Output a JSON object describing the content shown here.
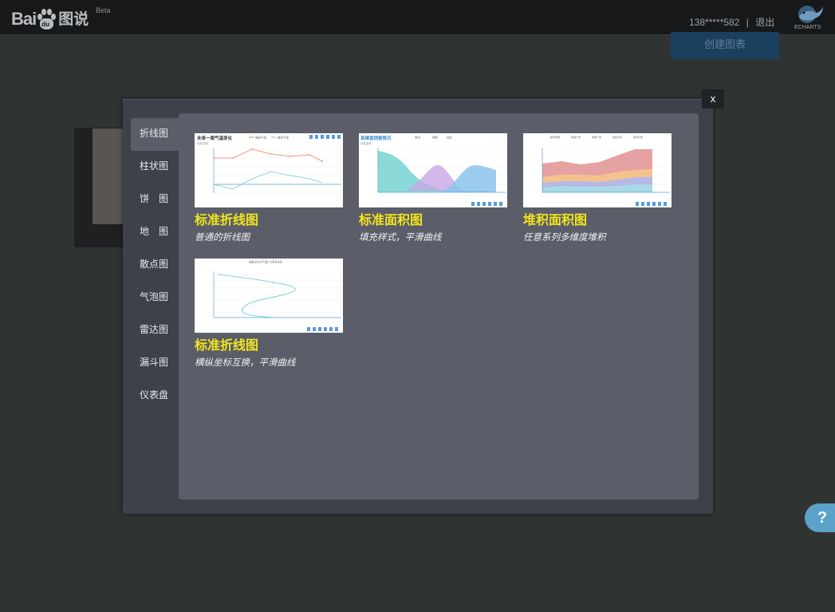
{
  "header": {
    "logo_bai": "Bai",
    "logo_du": "du",
    "logo_tushuo": "图说",
    "logo_beta": "Beta",
    "user_phone": "138*****582",
    "separator": "|",
    "logout_label": "退出",
    "echarts_label": "ECHARTS",
    "create_button_label": "创建图表"
  },
  "modal": {
    "close_label": "x",
    "tabs": [
      {
        "label": "折线图",
        "active": true
      },
      {
        "label": "柱状图"
      },
      {
        "label": "饼　图"
      },
      {
        "label": "地　图"
      },
      {
        "label": "散点图"
      },
      {
        "label": "气泡图"
      },
      {
        "label": "雷达图"
      },
      {
        "label": "漏斗图"
      },
      {
        "label": "仪表盘"
      }
    ],
    "cards": [
      {
        "title": "标准折线图",
        "desc": "普通的折线图",
        "thumb_title": "未来一周气温变化",
        "thumb_subtitle": "纯属虚构",
        "thumb_legend": [
          "最高气温",
          "最低气温"
        ]
      },
      {
        "title": "标准面积图",
        "desc": "填充样式，平滑曲线",
        "thumb_title": "某楼盘销售情况",
        "thumb_subtitle": "纯属虚构",
        "thumb_legend": [
          "意向",
          "预购",
          "成交"
        ]
      },
      {
        "title": "堆积面积图",
        "desc": "任意系列多维度堆积",
        "thumb_legend": [
          "邮件营销",
          "联盟广告",
          "视频广告",
          "直接访问",
          "搜索引擎"
        ]
      },
      {
        "title": "标准折线图",
        "desc": "横纵坐标互换，平滑曲线",
        "thumb_legend": [
          "高度(km)与气温(°C)变化关系"
        ]
      }
    ]
  },
  "help_label": "?",
  "colors": {
    "accent_title": "#f2e51c",
    "panel": "#5b5e69",
    "modal": "#3e4149",
    "create_button": "#1b3f5f",
    "help_button": "#5ca3cc"
  }
}
